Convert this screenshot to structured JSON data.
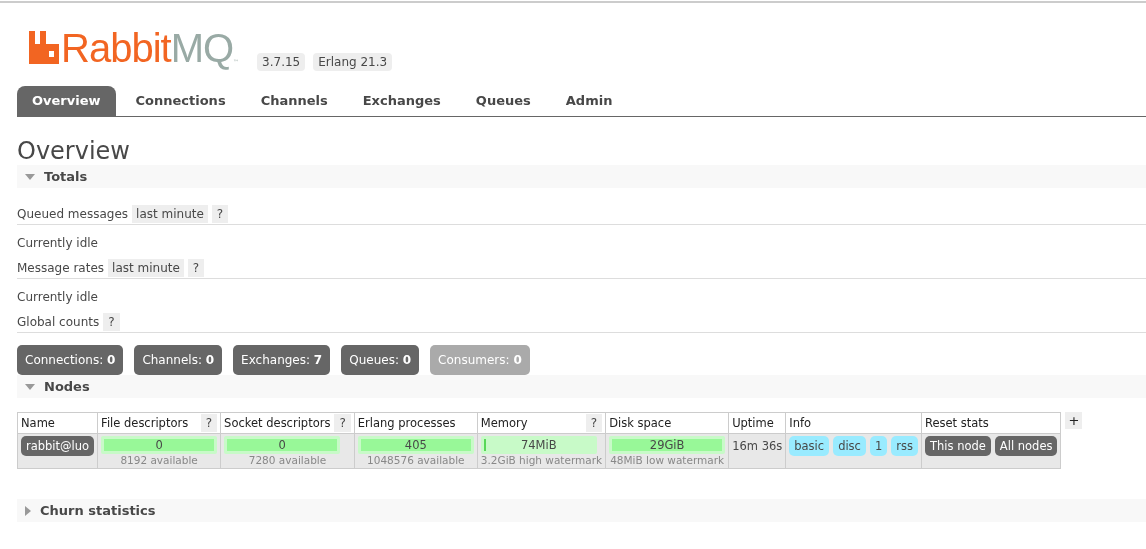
{
  "logo": {
    "word_a": "Rabbit",
    "word_b": "MQ",
    "trademark": "™"
  },
  "versions": [
    "3.7.15",
    "Erlang 21.3"
  ],
  "tabs": [
    {
      "label": "Overview",
      "selected": true
    },
    {
      "label": "Connections",
      "selected": false
    },
    {
      "label": "Channels",
      "selected": false
    },
    {
      "label": "Exchanges",
      "selected": false
    },
    {
      "label": "Queues",
      "selected": false
    },
    {
      "label": "Admin",
      "selected": false
    }
  ],
  "page_title": "Overview",
  "totals": {
    "title": "Totals",
    "expanded": true,
    "rows": [
      {
        "kind": "label",
        "label": "Queued messages",
        "range": "last minute",
        "help": "?"
      },
      {
        "kind": "text",
        "text": "Currently idle"
      },
      {
        "kind": "label",
        "label": "Message rates",
        "range": "last minute",
        "help": "?"
      },
      {
        "kind": "text",
        "text": "Currently idle"
      },
      {
        "kind": "label",
        "label": "Global counts",
        "help": "?"
      }
    ],
    "counts": [
      {
        "label": "Connections:",
        "value": "0",
        "disabled": false
      },
      {
        "label": "Channels:",
        "value": "0",
        "disabled": false
      },
      {
        "label": "Exchanges:",
        "value": "7",
        "disabled": false
      },
      {
        "label": "Queues:",
        "value": "0",
        "disabled": false
      },
      {
        "label": "Consumers:",
        "value": "0",
        "disabled": true
      }
    ]
  },
  "nodes": {
    "title": "Nodes",
    "expanded": true,
    "columns": [
      {
        "label": "Name"
      },
      {
        "label": "File descriptors",
        "help": "?"
      },
      {
        "label": "Socket descriptors",
        "help": "?"
      },
      {
        "label": "Erlang processes"
      },
      {
        "label": "Memory",
        "help": "?"
      },
      {
        "label": "Disk space"
      },
      {
        "label": "Uptime"
      },
      {
        "label": "Info"
      },
      {
        "label": "Reset stats"
      }
    ],
    "add_column": "+",
    "rows": [
      {
        "name": "rabbit@luo",
        "file_descriptors": {
          "value": "0",
          "note": "8192 available",
          "level": 1
        },
        "socket_descriptors": {
          "value": "0",
          "note": "7280 available",
          "level": 1
        },
        "erlang_processes": {
          "value": "405",
          "note": "1048576 available",
          "level": 1
        },
        "memory": {
          "value": "74MiB",
          "note": "3.2GiB high watermark",
          "level": 0.02
        },
        "disk_space": {
          "value": "29GiB",
          "note": "48MiB low watermark",
          "level": 1
        },
        "uptime": "16m 36s",
        "info": [
          "basic",
          "disc",
          "1",
          "rss"
        ],
        "reset": [
          "This node",
          "All nodes"
        ]
      }
    ]
  },
  "churn": {
    "title": "Churn statistics",
    "expanded": false
  }
}
